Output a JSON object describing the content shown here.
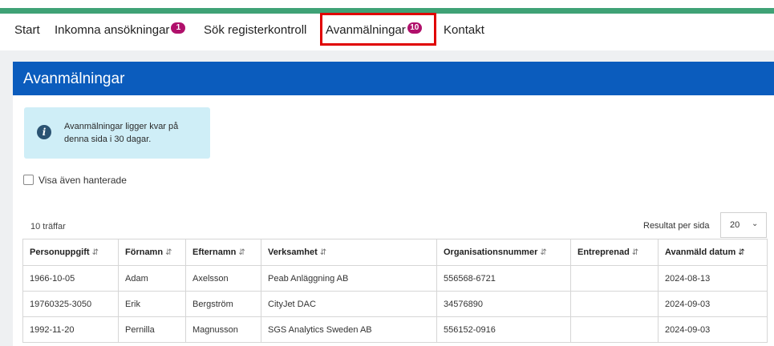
{
  "nav": {
    "items": [
      {
        "label": "Start"
      },
      {
        "label": "Inkomna ansökningar",
        "badge": "1"
      },
      {
        "label": "Sök registerkontroll"
      },
      {
        "label": "Avanmälningar",
        "badge": "10"
      },
      {
        "label": "Kontakt"
      }
    ]
  },
  "panel": {
    "title": "Avanmälningar",
    "info": "Avanmälningar ligger kvar på denna sida i 30 dagar.",
    "checkbox_label": "Visa även hanterade",
    "hits": "10 träffar",
    "per_page_label": "Resultat per sida",
    "per_page_value": "20"
  },
  "table": {
    "columns": [
      "Personuppgift",
      "Förnamn",
      "Efternamn",
      "Verksamhet",
      "Organisationsnummer",
      "Entreprenad",
      "Avanmäld datum"
    ],
    "rows": [
      [
        "1966-10-05",
        "Adam",
        "Axelsson",
        "Peab Anläggning AB",
        "556568-6721",
        "",
        "2024-08-13"
      ],
      [
        "19760325-3050",
        "Erik",
        "Bergström",
        "CityJet DAC",
        "34576890",
        "",
        "2024-09-03"
      ],
      [
        "1992-11-20",
        "Pernilla",
        "Magnusson",
        "SGS Analytics Sweden AB",
        "556152-0916",
        "",
        "2024-09-03"
      ]
    ]
  },
  "colors": {
    "accent_bar": "#3fa276",
    "header": "#0b5cbd",
    "badge": "#b0106b",
    "highlight": "#e00000"
  }
}
